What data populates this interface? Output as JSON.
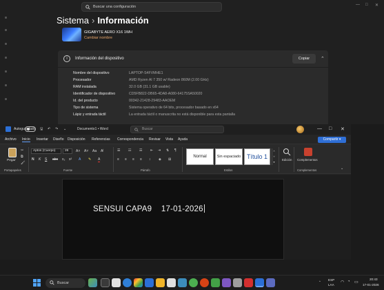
{
  "settings": {
    "search_placeholder": "Buscar una configuración",
    "breadcrumb_parent": "Sistema",
    "breadcrumb_sep": "›",
    "breadcrumb_current": "Información",
    "device_model": "GIGABYTE AERO X16 1WH",
    "rename_link": "Cambiar nombre",
    "window_controls": {
      "minimize": "—",
      "maximize": "□",
      "close": "✕"
    },
    "specs_section": {
      "title": "Información del dispositivo",
      "copy_button": "Copiar",
      "rows": [
        {
          "key": "Nombre del dispositivo",
          "value": "LAPTOP-S4FVMHE1"
        },
        {
          "key": "Procesador",
          "value": "AMD Ryzen AI 7 350 w/ Radeon 860M (2.00 GHz)"
        },
        {
          "key": "RAM instalada",
          "value": "32.0 GB (31.1 GB usable)"
        },
        {
          "key": "Identificador de dispositivo",
          "value": "CD5FB822-DB65-4DA8-A080-64175SA50020"
        },
        {
          "key": "Id. del producto",
          "value": "00342-21428-29483-AAOEM"
        },
        {
          "key": "Tipo de sistema",
          "value": "Sistema operativo de 64 bits, procesador basado en x64"
        },
        {
          "key": "Lápiz y entrada táctil",
          "value": "La entrada táctil o manuscrita no está disponible para esta pantalla"
        }
      ]
    }
  },
  "word": {
    "autosave_label": "Autoguardado",
    "toggle_state": "Off",
    "doc_title": "Documento1 • Word",
    "search_placeholder": "Buscar",
    "menu": [
      "Archivo",
      "Inicio",
      "Insertar",
      "Diseño",
      "Disposición",
      "Referencias",
      "Correspondencia",
      "Revisar",
      "Vista",
      "Ayuda"
    ],
    "active_menu_index": 1,
    "share_label": "Compartir",
    "ribbon": {
      "paste_label": "Pegar",
      "font_name": "Aptos (Cuerpo)",
      "font_size": "26",
      "styles": [
        "Normal",
        "Sin espaciado",
        "Título 1"
      ],
      "editing_label": "Edición",
      "addins_label": "Complementos",
      "groups": [
        "Portapapeles",
        "Fuente",
        "Párrafo",
        "Estilos",
        "Complementos"
      ]
    },
    "document_text": "SENSUI CAPA9    17-01-2026"
  },
  "taskbar": {
    "search_label": "Buscar",
    "lang": "ESP",
    "region": "LAA",
    "time": "20:43",
    "date": "17-01-2026"
  },
  "colors": {
    "accent": "#2f6fd6",
    "rename_link": "#e7a56a",
    "background": "#1b1b1b"
  }
}
